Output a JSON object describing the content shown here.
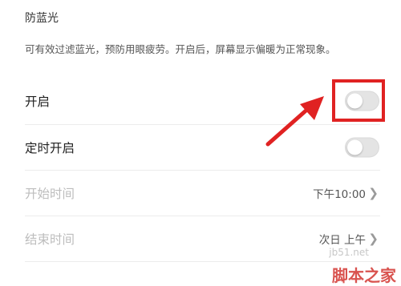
{
  "section": {
    "title": "防蓝光",
    "description": "可有效过滤蓝光，预防用眼疲劳。开启后，屏幕显示偏暖为正常现象。"
  },
  "settings": [
    {
      "label": "开启",
      "type": "toggle",
      "on": false,
      "enabled": true
    },
    {
      "label": "定时开启",
      "type": "toggle",
      "on": false,
      "enabled": true
    },
    {
      "label": "开始时间",
      "type": "value",
      "value": "下午10:00",
      "enabled": false
    },
    {
      "label": "结束时间",
      "type": "value",
      "value": "次日 上午",
      "enabled": false
    }
  ],
  "annotation": {
    "color": "#e02222",
    "target": "开启 toggle"
  },
  "watermark": {
    "site": "jb51.net",
    "brand": "脚本之家"
  },
  "icons": {
    "chevron": "chevron-right-icon"
  }
}
